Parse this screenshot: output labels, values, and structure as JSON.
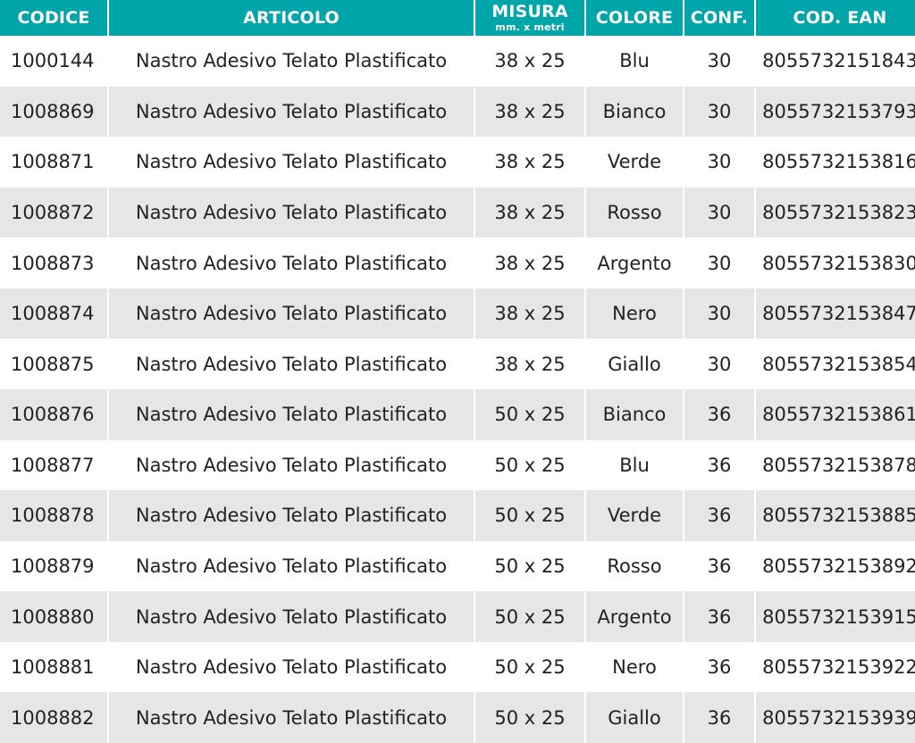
{
  "table": {
    "headers": {
      "codice": "CODICE",
      "articolo": "ARTICOLO",
      "misura": "MISURA",
      "misura_sub": "mm. x metri",
      "colore": "COLORE",
      "conf": "CONF.",
      "ean": "COD. EAN"
    },
    "rows": [
      {
        "codice": "1000144",
        "articolo": "Nastro Adesivo Telato Plastificato",
        "misura": "38 x 25",
        "colore": "Blu",
        "conf": "30",
        "ean": "8055732151843"
      },
      {
        "codice": "1008869",
        "articolo": "Nastro Adesivo Telato Plastificato",
        "misura": "38 x 25",
        "colore": "Bianco",
        "conf": "30",
        "ean": "8055732153793"
      },
      {
        "codice": "1008871",
        "articolo": "Nastro Adesivo Telato Plastificato",
        "misura": "38 x 25",
        "colore": "Verde",
        "conf": "30",
        "ean": "8055732153816"
      },
      {
        "codice": "1008872",
        "articolo": "Nastro Adesivo Telato Plastificato",
        "misura": "38 x 25",
        "colore": "Rosso",
        "conf": "30",
        "ean": "8055732153823"
      },
      {
        "codice": "1008873",
        "articolo": "Nastro Adesivo Telato Plastificato",
        "misura": "38 x 25",
        "colore": "Argento",
        "conf": "30",
        "ean": "8055732153830"
      },
      {
        "codice": "1008874",
        "articolo": "Nastro Adesivo Telato Plastificato",
        "misura": "38 x 25",
        "colore": "Nero",
        "conf": "30",
        "ean": "8055732153847"
      },
      {
        "codice": "1008875",
        "articolo": "Nastro Adesivo Telato Plastificato",
        "misura": "38 x 25",
        "colore": "Giallo",
        "conf": "30",
        "ean": "8055732153854"
      },
      {
        "codice": "1008876",
        "articolo": "Nastro Adesivo Telato Plastificato",
        "misura": "50 x 25",
        "colore": "Bianco",
        "conf": "36",
        "ean": "8055732153861"
      },
      {
        "codice": "1008877",
        "articolo": "Nastro Adesivo Telato Plastificato",
        "misura": "50 x 25",
        "colore": "Blu",
        "conf": "36",
        "ean": "8055732153878"
      },
      {
        "codice": "1008878",
        "articolo": "Nastro Adesivo Telato Plastificato",
        "misura": "50 x 25",
        "colore": "Verde",
        "conf": "36",
        "ean": "8055732153885"
      },
      {
        "codice": "1008879",
        "articolo": "Nastro Adesivo Telato Plastificato",
        "misura": "50 x 25",
        "colore": "Rosso",
        "conf": "36",
        "ean": "8055732153892"
      },
      {
        "codice": "1008880",
        "articolo": "Nastro Adesivo Telato Plastificato",
        "misura": "50 x 25",
        "colore": "Argento",
        "conf": "36",
        "ean": "8055732153915"
      },
      {
        "codice": "1008881",
        "articolo": "Nastro Adesivo Telato Plastificato",
        "misura": "50 x 25",
        "colore": "Nero",
        "conf": "36",
        "ean": "8055732153922"
      },
      {
        "codice": "1008882",
        "articolo": "Nastro Adesivo Telato Plastificato",
        "misura": "50 x 25",
        "colore": "Giallo",
        "conf": "36",
        "ean": "8055732153939"
      }
    ]
  },
  "colors": {
    "header_bg": "#00a5aa",
    "header_text": "#ffffff",
    "stripe_bg": "#e6e6e6",
    "text": "#222222"
  }
}
